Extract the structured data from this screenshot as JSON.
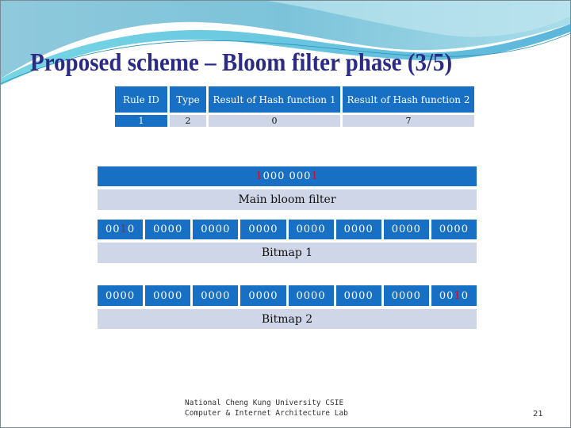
{
  "slide": {
    "title": "Proposed scheme – Bloom filter phase (3/5)",
    "page_number": "21",
    "footer": {
      "line1": "National Cheng Kung University CSIE",
      "line2": "Computer & Internet Architecture Lab"
    },
    "colors": {
      "title": "#2b2b86",
      "cell_blue": "#1770c4",
      "cell_light": "#ced6e8",
      "highlight_bit": "#c8102e"
    }
  },
  "rule_table": {
    "headers": [
      "Rule ID",
      "Type",
      "Result of Hash function 1",
      "Result of Hash function 2"
    ],
    "rows": [
      [
        "1",
        "2",
        "0",
        "7"
      ]
    ]
  },
  "main_bloom_filter": {
    "label": "Main bloom filter",
    "bits_parts": [
      {
        "text": "1",
        "highlight": true
      },
      {
        "text": "000 000",
        "highlight": false
      },
      {
        "text": "1",
        "highlight": true
      }
    ]
  },
  "bitmap1": {
    "label": "Bitmap 1",
    "cells": [
      [
        {
          "text": "00"
        },
        {
          "text": "1",
          "highlight": true
        },
        {
          "text": "0"
        }
      ],
      [
        {
          "text": "0000"
        }
      ],
      [
        {
          "text": "0000"
        }
      ],
      [
        {
          "text": "0000"
        }
      ],
      [
        {
          "text": "0000"
        }
      ],
      [
        {
          "text": "0000"
        }
      ],
      [
        {
          "text": "0000"
        }
      ],
      [
        {
          "text": "0000"
        }
      ]
    ]
  },
  "bitmap2": {
    "label": "Bitmap 2",
    "cells": [
      [
        {
          "text": "0000"
        }
      ],
      [
        {
          "text": "0000"
        }
      ],
      [
        {
          "text": "0000"
        }
      ],
      [
        {
          "text": "0000"
        }
      ],
      [
        {
          "text": "0000"
        }
      ],
      [
        {
          "text": "0000"
        }
      ],
      [
        {
          "text": "0000"
        }
      ],
      [
        {
          "text": "00"
        },
        {
          "text": "1",
          "highlight": true
        },
        {
          "text": "0"
        }
      ]
    ]
  }
}
